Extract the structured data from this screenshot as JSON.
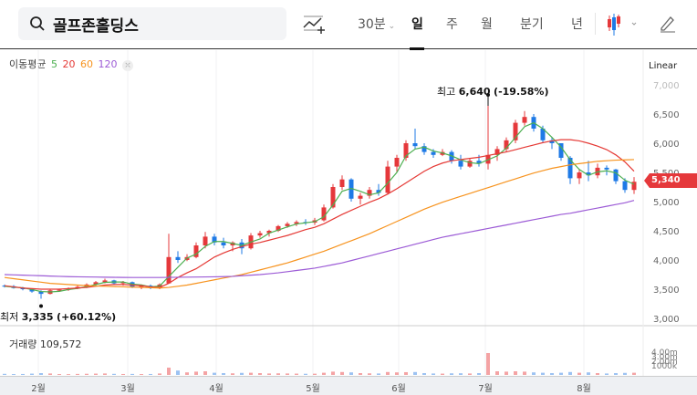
{
  "header": {
    "search_value": "골프존홀딩스",
    "interval_30m": "30분",
    "tabs": [
      {
        "label": "일",
        "active": true
      },
      {
        "label": "주"
      },
      {
        "label": "월"
      },
      {
        "label": "분기"
      },
      {
        "label": "년"
      }
    ],
    "icons": [
      "search-icon",
      "indicator-add-icon",
      "candle-type-icon",
      "pencil-icon"
    ]
  },
  "legend": {
    "title": "이동평균",
    "periods": [
      "5",
      "20",
      "60",
      "120"
    ],
    "colors": [
      "#4caf50",
      "#e53935",
      "#f7931e",
      "#9c5bd6"
    ]
  },
  "scale_mode": "Linear",
  "volume": {
    "label": "거래량",
    "value": "109,572",
    "axis_labels": [
      "4.00m",
      "3.00m",
      "2.00m",
      "1000k"
    ]
  },
  "current_price": "5,340",
  "annotations": {
    "high": {
      "label": "최고",
      "value": "6,640",
      "pct": "(-19.58%)"
    },
    "low": {
      "label": "최저",
      "value": "3,335",
      "pct": "(+60.12%)"
    }
  },
  "colors": {
    "up": "#e5383b",
    "down": "#1e7ae6"
  },
  "chart_data": {
    "type": "candlestick",
    "y_ticks": [
      "7,000",
      "6,500",
      "6,000",
      "5,500",
      "5,000",
      "4,500",
      "4,000",
      "3,500",
      "3,000"
    ],
    "ylim": [
      3000,
      7000
    ],
    "x_ticks": [
      "2월",
      "3월",
      "4월",
      "5월",
      "6월",
      "7월",
      "8월"
    ],
    "candles_ohlcv_k": [
      [
        3560,
        3580,
        3530,
        3550,
        150
      ],
      [
        3550,
        3570,
        3510,
        3520,
        120
      ],
      [
        3520,
        3540,
        3480,
        3500,
        130
      ],
      [
        3500,
        3510,
        3440,
        3460,
        180
      ],
      [
        3460,
        3480,
        3335,
        3420,
        250
      ],
      [
        3420,
        3500,
        3410,
        3480,
        200
      ],
      [
        3480,
        3510,
        3460,
        3490,
        120
      ],
      [
        3490,
        3530,
        3470,
        3510,
        110
      ],
      [
        3510,
        3560,
        3500,
        3540,
        140
      ],
      [
        3540,
        3600,
        3520,
        3580,
        160
      ],
      [
        3580,
        3640,
        3560,
        3620,
        180
      ],
      [
        3620,
        3680,
        3600,
        3650,
        200
      ],
      [
        3650,
        3660,
        3580,
        3600,
        150
      ],
      [
        3600,
        3640,
        3560,
        3620,
        130
      ],
      [
        3620,
        3630,
        3520,
        3540,
        140
      ],
      [
        3540,
        3580,
        3500,
        3560,
        120
      ],
      [
        3560,
        3580,
        3500,
        3520,
        130
      ],
      [
        3520,
        3600,
        3500,
        3580,
        200
      ],
      [
        3600,
        4450,
        3600,
        4050,
        1000
      ],
      [
        4050,
        4150,
        3950,
        4000,
        600
      ],
      [
        4000,
        4100,
        3980,
        4050,
        350
      ],
      [
        4050,
        4300,
        4030,
        4250,
        450
      ],
      [
        4250,
        4480,
        4200,
        4400,
        500
      ],
      [
        4400,
        4450,
        4250,
        4300,
        300
      ],
      [
        4300,
        4380,
        4200,
        4250,
        250
      ],
      [
        4250,
        4320,
        4150,
        4300,
        220
      ],
      [
        4300,
        4360,
        4100,
        4200,
        280
      ],
      [
        4200,
        4460,
        4180,
        4420,
        300
      ],
      [
        4420,
        4500,
        4380,
        4460,
        250
      ],
      [
        4460,
        4520,
        4400,
        4500,
        200
      ],
      [
        4500,
        4600,
        4480,
        4580,
        220
      ],
      [
        4580,
        4650,
        4550,
        4620,
        200
      ],
      [
        4620,
        4680,
        4580,
        4650,
        180
      ],
      [
        4650,
        4700,
        4600,
        4640,
        160
      ],
      [
        4640,
        4720,
        4600,
        4680,
        170
      ],
      [
        4680,
        4950,
        4660,
        4900,
        300
      ],
      [
        4900,
        5300,
        4880,
        5250,
        450
      ],
      [
        5250,
        5450,
        5200,
        5380,
        400
      ],
      [
        5380,
        5400,
        5000,
        5050,
        350
      ],
      [
        5050,
        5150,
        4950,
        5100,
        250
      ],
      [
        5100,
        5250,
        5050,
        5200,
        220
      ],
      [
        5200,
        5300,
        5100,
        5150,
        200
      ],
      [
        5150,
        5700,
        5120,
        5600,
        400
      ],
      [
        5600,
        5800,
        5500,
        5750,
        350
      ],
      [
        5750,
        6050,
        5700,
        6000,
        380
      ],
      [
        6000,
        6250,
        5900,
        5950,
        400
      ],
      [
        5950,
        6000,
        5800,
        5850,
        250
      ],
      [
        5850,
        5900,
        5750,
        5800,
        200
      ],
      [
        5800,
        5900,
        5780,
        5850,
        180
      ],
      [
        5850,
        5880,
        5650,
        5700,
        220
      ],
      [
        5700,
        5800,
        5550,
        5600,
        230
      ],
      [
        5600,
        5750,
        5580,
        5700,
        200
      ],
      [
        5700,
        5800,
        5600,
        5650,
        250
      ],
      [
        5650,
        6640,
        5550,
        5800,
        3000
      ],
      [
        5800,
        5950,
        5700,
        5900,
        500
      ],
      [
        5900,
        6100,
        5850,
        6050,
        450
      ],
      [
        6050,
        6400,
        6000,
        6350,
        500
      ],
      [
        6350,
        6550,
        6300,
        6450,
        450
      ],
      [
        6450,
        6500,
        6200,
        6250,
        350
      ],
      [
        6250,
        6300,
        6000,
        6050,
        300
      ],
      [
        6050,
        6100,
        5900,
        6000,
        250
      ],
      [
        6000,
        6000,
        5700,
        5750,
        300
      ],
      [
        5750,
        5780,
        5300,
        5400,
        400
      ],
      [
        5400,
        5550,
        5300,
        5500,
        300
      ],
      [
        5500,
        5700,
        5350,
        5450,
        350
      ],
      [
        5450,
        5650,
        5400,
        5580,
        250
      ],
      [
        5580,
        5620,
        5450,
        5550,
        200
      ],
      [
        5550,
        5560,
        5300,
        5350,
        250
      ],
      [
        5350,
        5400,
        5150,
        5200,
        280
      ],
      [
        5200,
        5420,
        5130,
        5340,
        300
      ]
    ],
    "ma_series": [
      {
        "name": "5",
        "values": null
      },
      {
        "name": "20",
        "values": [
          3560,
          3540,
          3520,
          3510,
          3500,
          3500,
          3500,
          3510,
          3520,
          3530,
          3550,
          3570,
          3580,
          3580,
          3570,
          3560,
          3540,
          3530,
          3600,
          3700,
          3780,
          3850,
          3950,
          4050,
          4120,
          4180,
          4230,
          4270,
          4300,
          4340,
          4380,
          4420,
          4470,
          4520,
          4560,
          4620,
          4700,
          4780,
          4850,
          4920,
          4990,
          5050,
          5130,
          5220,
          5320,
          5420,
          5520,
          5600,
          5660,
          5700,
          5720,
          5740,
          5760,
          5790,
          5820,
          5850,
          5890,
          5930,
          5970,
          6010,
          6040,
          6060,
          6060,
          6040,
          6000,
          5950,
          5890,
          5800,
          5680,
          5520
        ]
      },
      {
        "name": "60",
        "values": [
          3700,
          3680,
          3660,
          3640,
          3620,
          3600,
          3590,
          3580,
          3570,
          3560,
          3555,
          3550,
          3545,
          3540,
          3535,
          3530,
          3525,
          3520,
          3530,
          3550,
          3570,
          3600,
          3630,
          3660,
          3690,
          3720,
          3750,
          3790,
          3830,
          3870,
          3910,
          3950,
          4000,
          4050,
          4100,
          4150,
          4210,
          4270,
          4330,
          4390,
          4450,
          4520,
          4590,
          4660,
          4730,
          4800,
          4870,
          4930,
          4990,
          5040,
          5090,
          5140,
          5190,
          5240,
          5290,
          5340,
          5390,
          5440,
          5490,
          5530,
          5570,
          5600,
          5630,
          5650,
          5670,
          5690,
          5700,
          5710,
          5715,
          5720
        ]
      },
      {
        "name": "120",
        "values": [
          3750,
          3745,
          3740,
          3735,
          3730,
          3725,
          3720,
          3715,
          3712,
          3710,
          3708,
          3705,
          3703,
          3701,
          3700,
          3700,
          3700,
          3700,
          3702,
          3704,
          3706,
          3708,
          3710,
          3712,
          3715,
          3720,
          3730,
          3740,
          3750,
          3765,
          3780,
          3800,
          3820,
          3840,
          3860,
          3890,
          3920,
          3950,
          3990,
          4030,
          4070,
          4110,
          4150,
          4190,
          4230,
          4270,
          4310,
          4350,
          4390,
          4420,
          4450,
          4480,
          4510,
          4540,
          4570,
          4600,
          4630,
          4660,
          4690,
          4720,
          4750,
          4780,
          4800,
          4830,
          4860,
          4890,
          4920,
          4950,
          4980,
          5020
        ]
      }
    ]
  }
}
